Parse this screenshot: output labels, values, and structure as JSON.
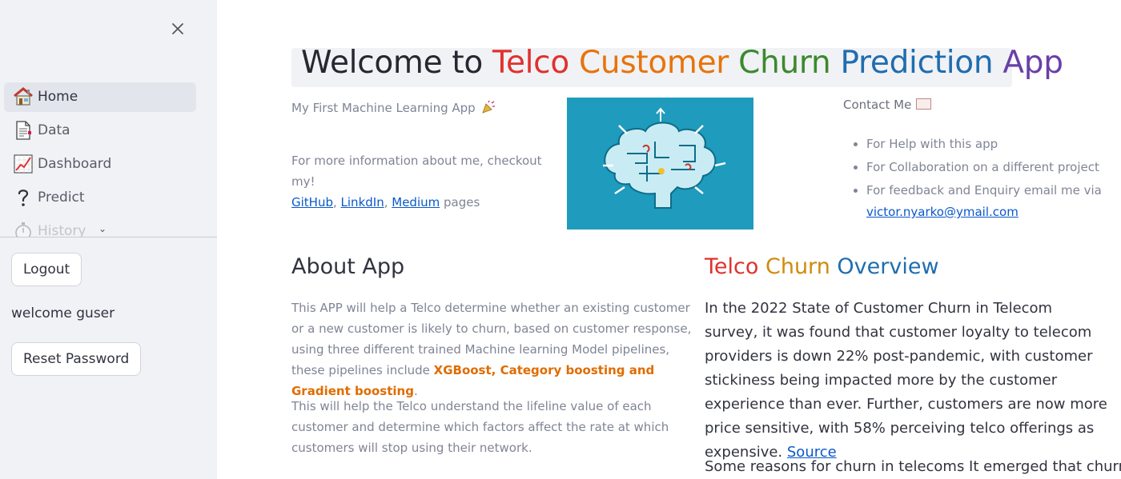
{
  "sidebar": {
    "nav": [
      {
        "label": "Home",
        "icon": "house-icon",
        "active": true
      },
      {
        "label": "Data",
        "icon": "document-icon"
      },
      {
        "label": "Dashboard",
        "icon": "chart-increasing-icon"
      },
      {
        "label": "Predict",
        "icon": "question-mark-icon"
      },
      {
        "label": "History",
        "icon": "stopwatch-icon"
      }
    ],
    "logout_label": "Logout",
    "welcome_text": "welcome guser",
    "reset_label": "Reset Password"
  },
  "main": {
    "title": {
      "prefix": "Welcome to ",
      "words": [
        "Telco",
        "Customer",
        "Churn",
        "Prediction",
        "App"
      ]
    },
    "first_app": "My First Machine Learning App",
    "more_info": {
      "text": "For more information about me, checkout my!",
      "links": [
        "GitHub",
        "LinkdIn",
        "Medium"
      ],
      "suffix": "pages"
    },
    "contact": {
      "heading": "Contact Me",
      "items": [
        "For Help with this app",
        "For Collaboration on a different project",
        "For feedback and Enquiry email me via"
      ],
      "email": "victor.nyarko@ymail.com"
    },
    "about": {
      "heading": "About App",
      "p1_start": "This APP will help a Telco determine whether an existing customer or a new customer is likely to churn, based on customer response, using three different trained Machine learning Model pipelines, these pipelines include ",
      "p1_highlight": "XGBoost, Category boosting and Gradient boosting",
      "p1_end": ".",
      "p2": "This will help the Telco understand the lifeline value of each customer and determine which factors affect the rate at which customers will stop using their network."
    },
    "overview": {
      "heading_words": [
        "Telco",
        "Churn",
        "Overview"
      ],
      "p1": "In the 2022 State of Customer Churn in Telecom survey, it was found that customer loyalty to telecom providers is down 22% post-pandemic, with customer stickiness being impacted more by the customer experience than ever. Further, customers are now more price sensitive, with 58% perceiving telco offerings as expensive. ",
      "source_label": "Source",
      "p2": "Some reasons for churn in telecoms It emerged that churn in the"
    }
  }
}
